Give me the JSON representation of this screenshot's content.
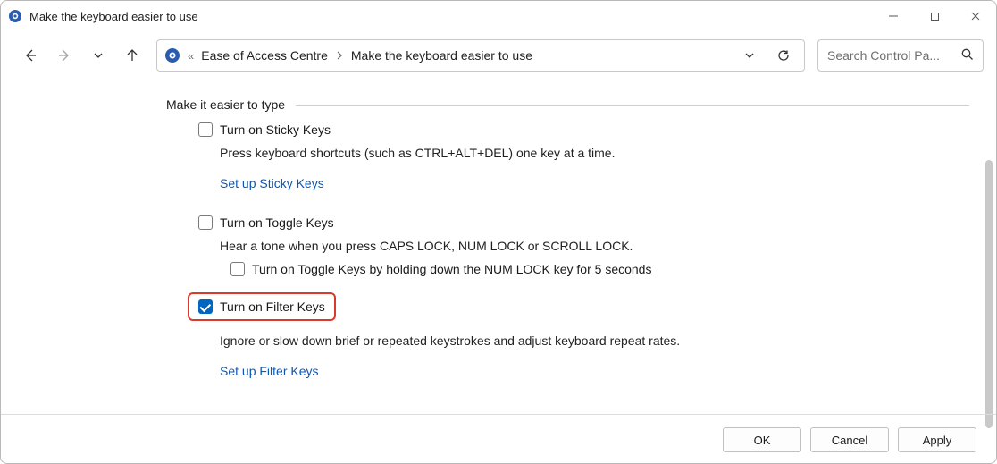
{
  "titlebar": {
    "title": "Make the keyboard easier to use"
  },
  "breadcrumb": {
    "root_glyph": "«",
    "segment1": "Ease of Access Centre",
    "segment2": "Make the keyboard easier to use"
  },
  "search": {
    "placeholder": "Search Control Pa..."
  },
  "section": {
    "heading": "Make it easier to type"
  },
  "sticky": {
    "label": "Turn on Sticky Keys",
    "checked": false,
    "desc": "Press keyboard shortcuts (such as CTRL+ALT+DEL) one key at a time.",
    "link": "Set up Sticky Keys"
  },
  "toggle": {
    "label": "Turn on Toggle Keys",
    "checked": false,
    "desc": "Hear a tone when you press CAPS LOCK, NUM LOCK or SCROLL LOCK.",
    "sub_label": "Turn on Toggle Keys by holding down the NUM LOCK key for 5 seconds",
    "sub_checked": false
  },
  "filter": {
    "label": "Turn on Filter Keys",
    "checked": true,
    "desc": "Ignore or slow down brief or repeated keystrokes and adjust keyboard repeat rates.",
    "link": "Set up Filter Keys"
  },
  "buttons": {
    "ok": "OK",
    "cancel": "Cancel",
    "apply": "Apply"
  }
}
